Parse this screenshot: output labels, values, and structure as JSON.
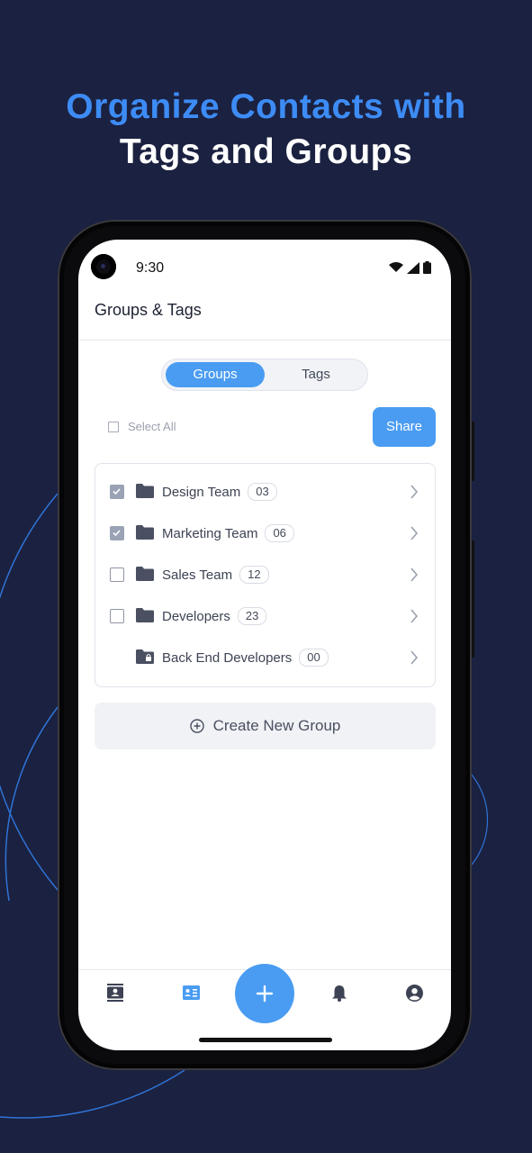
{
  "headline": {
    "line1": "Organize Contacts with",
    "line2": "Tags and Groups"
  },
  "colors": {
    "background": "#1b2140",
    "accent": "#3d8cf5",
    "primary_button": "#4a9cf2"
  },
  "status_bar": {
    "time": "9:30",
    "icons": [
      "wifi-icon",
      "signal-icon",
      "battery-icon"
    ]
  },
  "app": {
    "title": "Groups & Tags"
  },
  "segmented": {
    "groups_label": "Groups",
    "tags_label": "Tags",
    "selected": "Groups"
  },
  "select_all_label": "Select All",
  "share_label": "Share",
  "groups": [
    {
      "name": "Design Team",
      "count": "03",
      "checked": true,
      "icon": "folder-icon"
    },
    {
      "name": "Marketing Team",
      "count": "06",
      "checked": true,
      "icon": "folder-icon"
    },
    {
      "name": "Sales Team",
      "count": "12",
      "checked": false,
      "icon": "folder-icon"
    },
    {
      "name": "Developers",
      "count": "23",
      "checked": false,
      "icon": "folder-icon"
    },
    {
      "name": "Back End Developers",
      "count": "00",
      "checked": false,
      "icon": "locked-folder-icon"
    }
  ],
  "create_group_label": "Create New Group",
  "bottom_nav": {
    "items": [
      "contacts-book-icon",
      "contact-card-icon",
      "add-icon",
      "bell-icon",
      "account-icon"
    ],
    "active": "contact-card-icon"
  }
}
